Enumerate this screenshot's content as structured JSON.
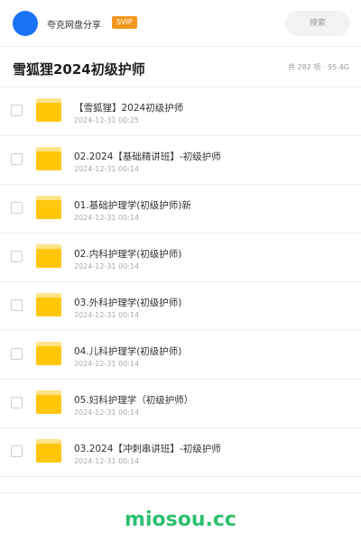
{
  "header": {
    "owner_name": "夸克网盘分享",
    "vip_badge": "SVIP",
    "search_label": "搜索",
    "colors": {
      "avatar": "#1a73f5",
      "vip": "#f7961e"
    }
  },
  "folder": {
    "title": "雪狐狸2024初级护师",
    "summary": "共 282 项 · 95.4G"
  },
  "items": [
    {
      "name": "【雪狐狸】2024初级护师",
      "date": "2024-12-31 00:25",
      "icon": "folder-icon"
    },
    {
      "name": "02.2024【基础精讲班】-初级护师",
      "date": "2024-12-31 00:14",
      "icon": "folder-icon"
    },
    {
      "name": "01.基础护理学(初级护师)新",
      "date": "2024-12-31 00:14",
      "icon": "folder-icon"
    },
    {
      "name": "02.内科护理学(初级护师)",
      "date": "2024-12-31 00:14",
      "icon": "folder-icon"
    },
    {
      "name": "03.外科护理学(初级护师)",
      "date": "2024-12-31 00:14",
      "icon": "folder-icon"
    },
    {
      "name": "04.儿科护理学(初级护师)",
      "date": "2024-12-31 00:14",
      "icon": "folder-icon"
    },
    {
      "name": "05.妇科护理学（初级护师）",
      "date": "2024-12-31 00:14",
      "icon": "folder-icon"
    },
    {
      "name": "03.2024【冲刺串讲班】-初级护师",
      "date": "2024-12-31 00:14",
      "icon": "folder-icon"
    }
  ],
  "footer": {
    "watermark": "miosou.cc",
    "color": "#2fbf71"
  }
}
